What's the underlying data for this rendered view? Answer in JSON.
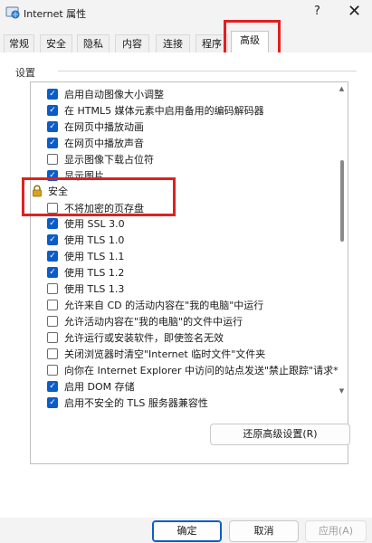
{
  "window": {
    "title": "Internet 属性",
    "help_glyph": "?",
    "close_glyph": "✕",
    "icon": "internet-options-icon"
  },
  "tabs": [
    {
      "label": "常规",
      "active": false
    },
    {
      "label": "安全",
      "active": false
    },
    {
      "label": "隐私",
      "active": false
    },
    {
      "label": "内容",
      "active": false
    },
    {
      "label": "连接",
      "active": false
    },
    {
      "label": "程序",
      "active": false
    },
    {
      "label": "高级",
      "active": true
    }
  ],
  "settings": {
    "section_label": "设置",
    "items": [
      {
        "label": "启用自动图像大小调整",
        "checked": true
      },
      {
        "label": "在 HTML5 媒体元素中启用备用的编码解码器",
        "checked": true
      },
      {
        "label": "在网页中播放动画",
        "checked": true
      },
      {
        "label": "在网页中播放声音",
        "checked": true
      },
      {
        "label": "显示图像下载占位符",
        "checked": false
      },
      {
        "label": "显示图片",
        "checked": true
      }
    ],
    "group": {
      "label": "安全",
      "icon": "lock-icon"
    },
    "security_items": [
      {
        "label": "不将加密的页存盘",
        "checked": false
      },
      {
        "label": "使用 SSL 3.0",
        "checked": true
      },
      {
        "label": "使用 TLS 1.0",
        "checked": true
      },
      {
        "label": "使用 TLS 1.1",
        "checked": true
      },
      {
        "label": "使用 TLS 1.2",
        "checked": true
      },
      {
        "label": "使用 TLS 1.3",
        "checked": false
      },
      {
        "label": "允许来自 CD 的活动内容在\"我的电脑\"中运行",
        "checked": false
      },
      {
        "label": "允许活动内容在\"我的电脑\"的文件中运行",
        "checked": false
      },
      {
        "label": "允许运行或安装软件，即使签名无效",
        "checked": false
      },
      {
        "label": "关闭浏览器时清空\"Internet 临时文件\"文件夹",
        "checked": false
      },
      {
        "label": "向你在 Internet Explorer 中访问的站点发送\"禁止跟踪\"请求*",
        "checked": false
      },
      {
        "label": "启用 DOM 存储",
        "checked": true
      },
      {
        "label": "启用不安全的 TLS 服务器兼容性",
        "checked": true
      }
    ]
  },
  "buttons": {
    "restore_advanced": "还原高级设置(R)",
    "ok": "确定",
    "cancel": "取消",
    "apply": "应用(A)"
  },
  "colors": {
    "accent": "#0b5cc7",
    "highlight_box": "#e02020",
    "lock_body": "#d9a21b"
  }
}
